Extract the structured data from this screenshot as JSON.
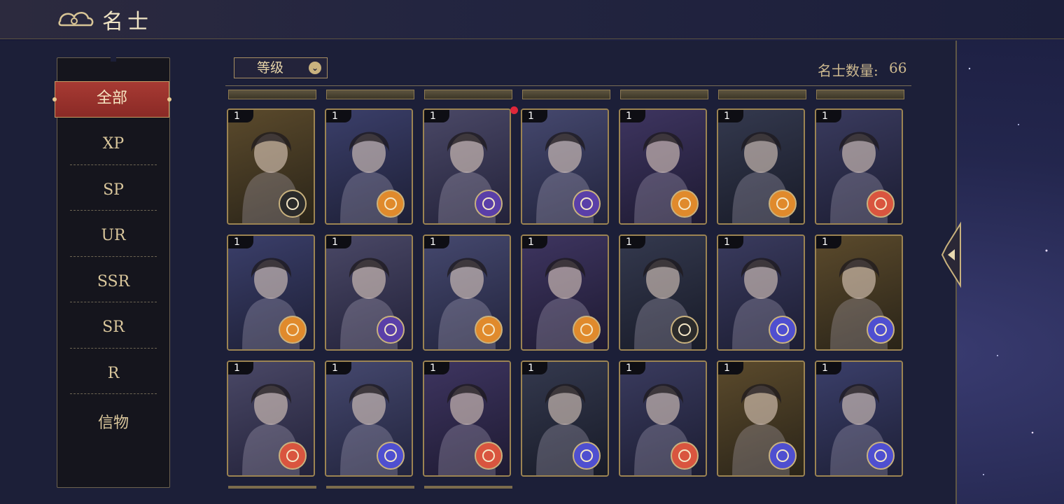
{
  "header": {
    "title": "名士"
  },
  "sidebar": {
    "tabs": [
      {
        "label": "全部",
        "active": true
      },
      {
        "label": "XP"
      },
      {
        "label": "SP"
      },
      {
        "label": "UR"
      },
      {
        "label": "SSR"
      },
      {
        "label": "SR"
      },
      {
        "label": "R"
      },
      {
        "label": "信物"
      }
    ]
  },
  "toolbar": {
    "sort_label": "等级",
    "count_label": "名士数量:",
    "count_value": "66"
  },
  "cards": [
    {
      "level": "1",
      "badge": "dark",
      "new": false
    },
    {
      "level": "1",
      "badge": "orange",
      "new": false
    },
    {
      "level": "1",
      "badge": "purple",
      "new": true
    },
    {
      "level": "1",
      "badge": "purple",
      "new": false
    },
    {
      "level": "1",
      "badge": "orange",
      "new": false
    },
    {
      "level": "1",
      "badge": "orange",
      "new": false
    },
    {
      "level": "1",
      "badge": "red",
      "new": false
    },
    {
      "level": "1",
      "badge": "orange",
      "new": false
    },
    {
      "level": "1",
      "badge": "purple",
      "new": false
    },
    {
      "level": "1",
      "badge": "orange",
      "new": false
    },
    {
      "level": "1",
      "badge": "orange",
      "new": false
    },
    {
      "level": "1",
      "badge": "dark",
      "new": false
    },
    {
      "level": "1",
      "badge": "blue",
      "new": false
    },
    {
      "level": "1",
      "badge": "blue",
      "new": false
    },
    {
      "level": "1",
      "badge": "red",
      "new": false
    },
    {
      "level": "1",
      "badge": "blue",
      "new": false
    },
    {
      "level": "1",
      "badge": "red",
      "new": false
    },
    {
      "level": "1",
      "badge": "blue",
      "new": false
    },
    {
      "level": "1",
      "badge": "red",
      "new": false
    },
    {
      "level": "1",
      "badge": "blue",
      "new": false
    },
    {
      "level": "1",
      "badge": "blue",
      "new": false
    }
  ],
  "colors": {
    "accent_red": "#8a2a26",
    "gold": "#c9b27e",
    "badge_orange": "#e08a2c",
    "badge_purple": "#5a3fa8",
    "badge_red": "#d9553f",
    "badge_blue": "#4f4fd0",
    "badge_dark": "#2b2b2b"
  }
}
